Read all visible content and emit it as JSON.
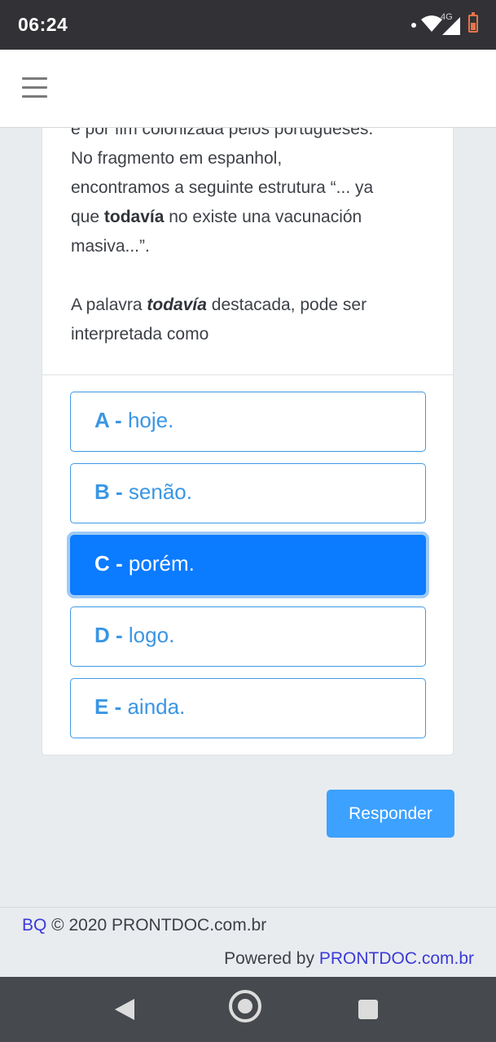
{
  "status_bar": {
    "time": "06:24",
    "network": "4G"
  },
  "question": {
    "line_partial": "e por fim colonizada pelos portugueses.",
    "line_1": "No fragmento em espanhol,",
    "line_2": "encontramos a seguinte estrutura “... ya",
    "line_3_pre": "que ",
    "line_3_bold": "todavía",
    "line_3_post": " no existe una vacunación",
    "line_4": "masiva...”.",
    "p2_pre": "A palavra ",
    "p2_bold": "todavía",
    "p2_post": " destacada, pode ser",
    "p2_line2": "interpretada como"
  },
  "options": [
    {
      "letter": "A -",
      "text": "hoje.",
      "selected": false
    },
    {
      "letter": "B -",
      "text": "senão.",
      "selected": false
    },
    {
      "letter": "C -",
      "text": "porém.",
      "selected": true
    },
    {
      "letter": "D -",
      "text": "logo.",
      "selected": false
    },
    {
      "letter": "E -",
      "text": "ainda.",
      "selected": false
    }
  ],
  "submit_label": "Responder",
  "footer": {
    "link_bq": "BQ",
    "copyright": " © 2020 PRONTDOC.com.br",
    "powered_prefix": "Powered by ",
    "powered_link": "PRONTDOC.com.br"
  },
  "colors": {
    "accent": "#3a96e4",
    "selected_bg": "#0b7bff",
    "button_bg": "#3da1ff",
    "link": "#3b3ad8"
  }
}
